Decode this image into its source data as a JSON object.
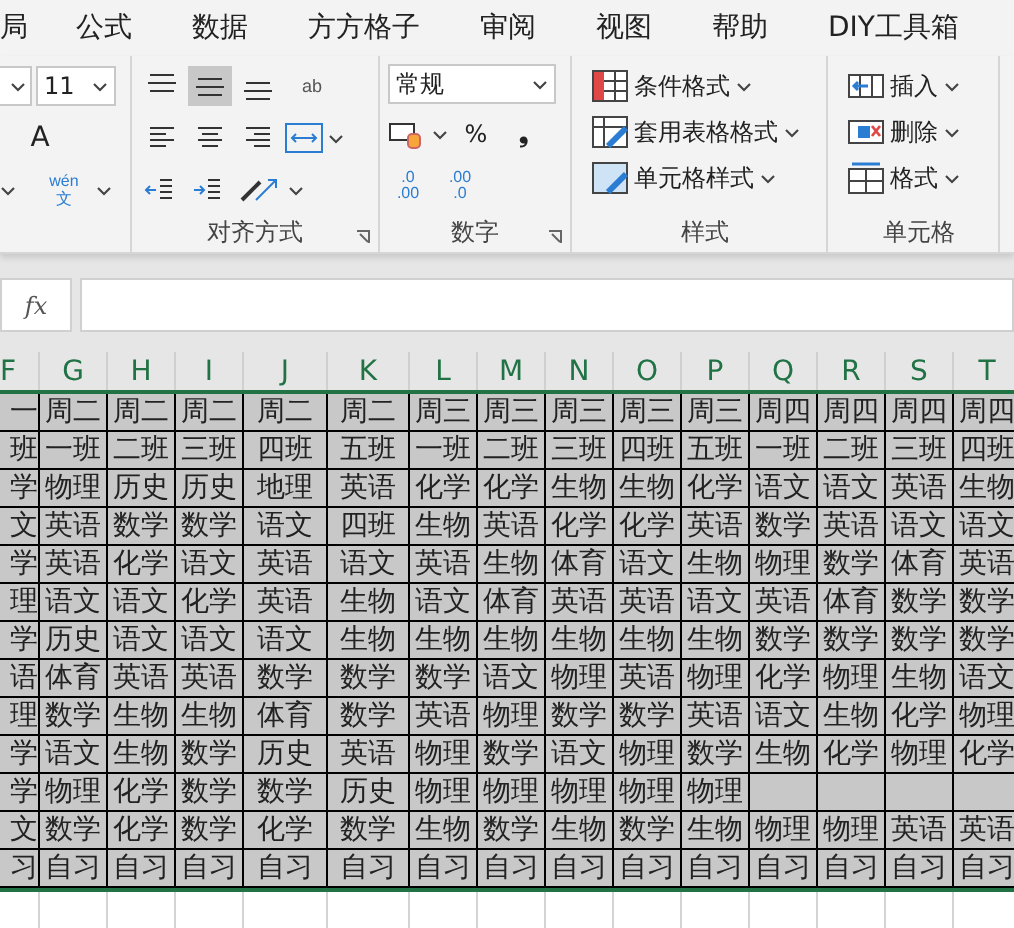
{
  "menu_tabs": [
    "局",
    "公式",
    "数据",
    "方方格子",
    "审阅",
    "视图",
    "帮助",
    "DIY工具箱"
  ],
  "font_group": {
    "size": "11",
    "grow_label": "A",
    "phonetic_top": "wén",
    "phonetic_bottom": "文"
  },
  "alignment_group": {
    "label": "对齐方式",
    "vertical_buttons": [
      {
        "kind": "top",
        "selected": false
      },
      {
        "kind": "middle",
        "selected": true
      },
      {
        "kind": "bottom",
        "selected": false
      }
    ],
    "wrap_label": "ab"
  },
  "number_group": {
    "label": "数字",
    "format": "常规",
    "percent": "%",
    "comma": "❟",
    "decimal_increase": {
      "top": ".0",
      "bottom": ".00"
    },
    "decimal_decrease": {
      "top": ".00",
      "bottom": ".0"
    }
  },
  "styles_group": {
    "label": "样式",
    "items": [
      {
        "kind": "conditional",
        "label": "条件格式"
      },
      {
        "kind": "table",
        "label": "套用表格格式"
      },
      {
        "kind": "cellstyle",
        "label": "单元格样式"
      }
    ]
  },
  "cells_group": {
    "label": "单元格",
    "items": [
      {
        "kind": "insert",
        "label": "插入"
      },
      {
        "kind": "delete",
        "label": "删除"
      },
      {
        "kind": "format",
        "label": "格式"
      }
    ]
  },
  "formula_bar": {
    "fx": "fx"
  },
  "sheet": {
    "columns": [
      "F",
      "G",
      "H",
      "I",
      "J",
      "K",
      "L",
      "M",
      "N",
      "O",
      "P",
      "Q",
      "R",
      "S",
      "T"
    ],
    "rows": [
      [
        "一",
        "周二",
        "周二",
        "周二",
        "周二",
        "周二",
        "周三",
        "周三",
        "周三",
        "周三",
        "周三",
        "周四",
        "周四",
        "周四",
        "周四"
      ],
      [
        "班",
        "一班",
        "二班",
        "三班",
        "四班",
        "五班",
        "一班",
        "二班",
        "三班",
        "四班",
        "五班",
        "一班",
        "二班",
        "三班",
        "四班"
      ],
      [
        "学",
        "物理",
        "历史",
        "历史",
        "地理",
        "英语",
        "化学",
        "化学",
        "生物",
        "生物",
        "化学",
        "语文",
        "语文",
        "英语",
        "生物"
      ],
      [
        "文",
        "英语",
        "数学",
        "数学",
        "语文",
        "四班",
        "生物",
        "英语",
        "化学",
        "化学",
        "英语",
        "数学",
        "英语",
        "语文",
        "语文"
      ],
      [
        "学",
        "英语",
        "化学",
        "语文",
        "英语",
        "语文",
        "英语",
        "生物",
        "体育",
        "语文",
        "生物",
        "物理",
        "数学",
        "体育",
        "英语"
      ],
      [
        "理",
        "语文",
        "语文",
        "化学",
        "英语",
        "生物",
        "语文",
        "体育",
        "英语",
        "英语",
        "语文",
        "英语",
        "体育",
        "数学",
        "数学"
      ],
      [
        "学",
        "历史",
        "语文",
        "语文",
        "语文",
        "生物",
        "生物",
        "生物",
        "生物",
        "生物",
        "生物",
        "数学",
        "数学",
        "数学",
        "数学"
      ],
      [
        "语",
        "体育",
        "英语",
        "英语",
        "数学",
        "数学",
        "数学",
        "语文",
        "物理",
        "英语",
        "物理",
        "化学",
        "物理",
        "生物",
        "语文"
      ],
      [
        "理",
        "数学",
        "生物",
        "生物",
        "体育",
        "数学",
        "英语",
        "物理",
        "数学",
        "数学",
        "英语",
        "语文",
        "生物",
        "化学",
        "物理"
      ],
      [
        "学",
        "语文",
        "生物",
        "数学",
        "历史",
        "英语",
        "物理",
        "数学",
        "语文",
        "物理",
        "数学",
        "生物",
        "化学",
        "物理",
        "化学"
      ],
      [
        "学",
        "物理",
        "化学",
        "数学",
        "数学",
        "历史",
        "物理",
        "物理",
        "物理",
        "物理",
        "物理",
        null,
        null,
        null,
        null
      ],
      [
        "文",
        "数学",
        "化学",
        "数学",
        "化学",
        "数学",
        "生物",
        "数学",
        "生物",
        "数学",
        "生物",
        "物理",
        "物理",
        "英语",
        "英语"
      ],
      [
        "习",
        "自习",
        "自习",
        "自习",
        "自习",
        "自习",
        "自习",
        "自习",
        "自习",
        "自习",
        "自习",
        "自习",
        "自习",
        "自习",
        "自习"
      ]
    ]
  }
}
